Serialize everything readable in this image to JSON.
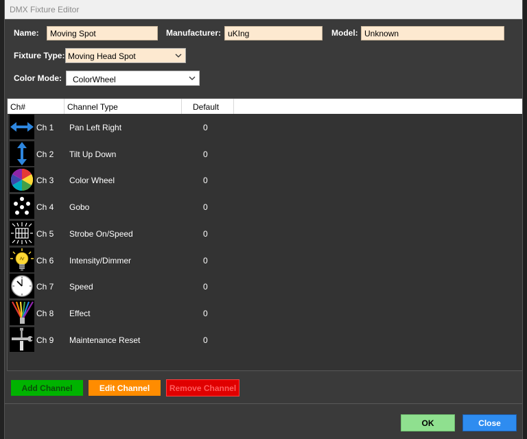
{
  "window": {
    "title": "DMX Fixture Editor"
  },
  "form": {
    "name_label": "Name:",
    "name_value": "Moving Spot",
    "manufacturer_label": "Manufacturer:",
    "manufacturer_value": "uKIng",
    "model_label": "Model:",
    "model_value": "Unknown",
    "fixture_type_label": "Fixture Type:",
    "fixture_type_value": "Moving Head Spot",
    "color_mode_label": "Color Mode:",
    "color_mode_value": "ColorWheel"
  },
  "grid": {
    "headers": [
      "Ch#",
      "Channel Type",
      "Default"
    ],
    "rows": [
      {
        "ch": "Ch 1",
        "type": "Pan Left Right",
        "default": "0",
        "icon": "pan-arrows-icon"
      },
      {
        "ch": "Ch 2",
        "type": "Tilt Up Down",
        "default": "0",
        "icon": "tilt-arrows-icon"
      },
      {
        "ch": "Ch 3",
        "type": "Color Wheel",
        "default": "0",
        "icon": "color-wheel-icon"
      },
      {
        "ch": "Ch 4",
        "type": "Gobo",
        "default": "0",
        "icon": "gobo-dots-icon"
      },
      {
        "ch": "Ch 5",
        "type": "Strobe On/Speed",
        "default": "0",
        "icon": "strobe-icon"
      },
      {
        "ch": "Ch 6",
        "type": "Intensity/Dimmer",
        "default": "0",
        "icon": "lightbulb-icon"
      },
      {
        "ch": "Ch 7",
        "type": "Speed",
        "default": "0",
        "icon": "clock-icon"
      },
      {
        "ch": "Ch 8",
        "type": "Effect",
        "default": "0",
        "icon": "rainbow-effect-icon"
      },
      {
        "ch": "Ch 9",
        "type": "Maintenance Reset",
        "default": "0",
        "icon": "wrench-screwdriver-icon"
      }
    ]
  },
  "buttons": {
    "add_channel": "Add Channel",
    "edit_channel": "Edit Channel",
    "remove_channel": "Remove Channel",
    "ok": "OK",
    "close": "Close"
  },
  "colors": {
    "add": "#00b300",
    "edit": "#ff8c00",
    "remove": "#e00000",
    "ok": "#8fe08f",
    "close": "#2e8cf0",
    "field_bg": "#fde9d0"
  }
}
